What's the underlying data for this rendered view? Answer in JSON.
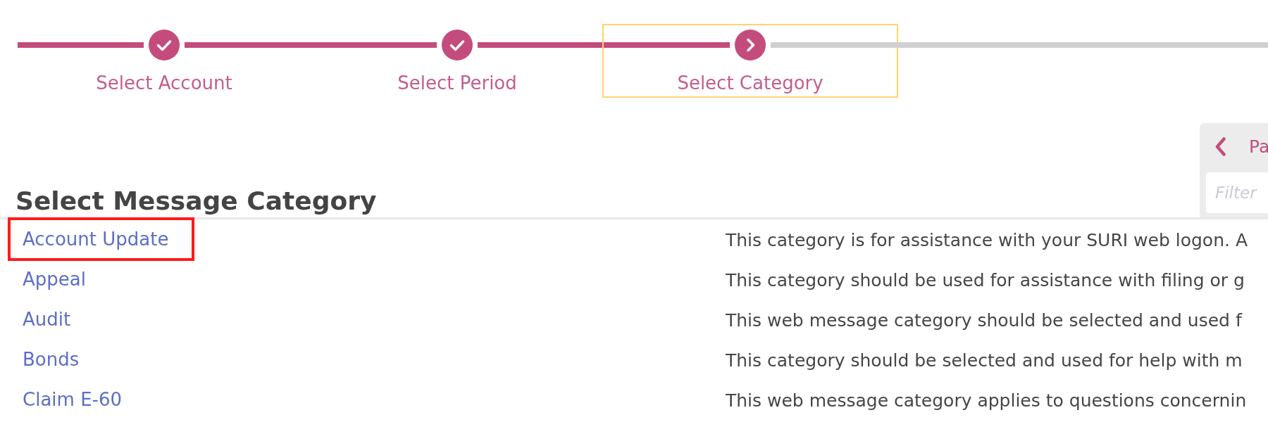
{
  "stepper": {
    "steps": [
      {
        "label": "Select Account",
        "completed": true,
        "selected": false
      },
      {
        "label": "Select Period",
        "completed": true,
        "selected": false
      },
      {
        "label": "Select Category",
        "completed": false,
        "selected": true
      }
    ]
  },
  "heading": "Select Message Category",
  "side_panel": {
    "back_link": {
      "label": "Pa"
    },
    "filter": {
      "placeholder": "Filter"
    }
  },
  "categories": [
    {
      "name": "Account Update",
      "description": "This category is for assistance with your SURI web logon. A",
      "highlighted": true
    },
    {
      "name": "Appeal",
      "description": "This category should be used for assistance with filing or g",
      "highlighted": false
    },
    {
      "name": "Audit",
      "description": "This web message category should be selected and used f",
      "highlighted": false
    },
    {
      "name": "Bonds",
      "description": "This category should be selected and used for help with m",
      "highlighted": false
    },
    {
      "name": "Claim E-60",
      "description": "This web message category applies to questions concernin",
      "highlighted": false
    }
  ]
}
